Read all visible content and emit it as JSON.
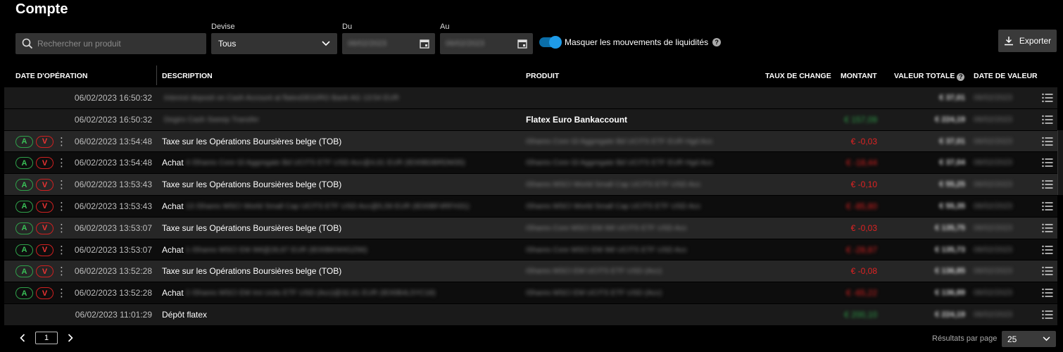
{
  "header": {
    "title": "Compte"
  },
  "filters": {
    "search_placeholder": "Rechercher un produit",
    "currency_label": "Devise",
    "currency_value": "Tous",
    "from_label": "Du",
    "from_value": "06/02/2023",
    "to_label": "Au",
    "to_value": "06/02/2023",
    "toggle_label": "Masquer les mouvements de liquidités",
    "toggle_on": true,
    "export_label": "Exporter"
  },
  "table": {
    "columns": {
      "op_date": "DATE D'OPÉRATION",
      "description": "DESCRIPTION",
      "product": "PRODUIT",
      "fx": "TAUX DE CHANGE",
      "amount": "MONTANT",
      "total": "VALEUR TOTALE",
      "value_date": "DATE DE VALEUR"
    },
    "buy_label": "A",
    "sell_label": "V",
    "rows": [
      {
        "has_actions": false,
        "datetime": "06/02/2023 16:50:32",
        "desc": "",
        "desc_blur": "Interest deposit on Cash Account at flatexDEGIRO Bank AG 13:54 EUR",
        "product": "",
        "product_blur": "",
        "amount": "",
        "amount_blur": true,
        "amount_pos": false,
        "total": "€ 37,01",
        "value_date": "06/02/2023"
      },
      {
        "has_actions": false,
        "datetime": "06/02/2023 16:50:32",
        "desc": "",
        "desc_blur": "Degiro Cash Sweep Transfer",
        "product": "Flatex Euro Bankaccount",
        "product_blur": "",
        "amount": "€ 157,09",
        "amount_blur": true,
        "amount_pos": true,
        "total": "€ 224,19",
        "value_date": "06/02/2023"
      },
      {
        "has_actions": true,
        "datetime": "06/02/2023 13:54:48",
        "desc": "Taxe sur les Opérations Boursières belge (TOB)",
        "desc_blur": "",
        "product": "",
        "product_blur": "iShares Core Gl Aggregate Bd UCITS ETF EUR Hgd Acc",
        "amount": "€ -0,03",
        "amount_blur": false,
        "amount_pos": false,
        "total": "€ 37,01",
        "value_date": "06/02/2023"
      },
      {
        "has_actions": true,
        "datetime": "06/02/2023 13:54:48",
        "desc": "Achat",
        "desc_blur": "4 iShares Core Gl Aggregate Bd UCITS ETF USD Acc@4,61 EUR (IE00BDBRDM35)",
        "product": "",
        "product_blur": "iShares Core Gl Aggregate Bd UCITS ETF EUR Hgd Acc",
        "amount": "€ -18,44",
        "amount_blur": true,
        "amount_pos": false,
        "total": "€ 37,04",
        "value_date": "06/02/2023"
      },
      {
        "has_actions": true,
        "datetime": "06/02/2023 13:53:43",
        "desc": "Taxe sur les Opérations Boursières belge (TOB)",
        "desc_blur": "",
        "product": "",
        "product_blur": "iShares MSCI World Small Cap UCITS ETF USD Acc",
        "amount": "€ -0,10",
        "amount_blur": false,
        "amount_pos": false,
        "total": "€ 55,25",
        "value_date": "06/02/2023"
      },
      {
        "has_actions": true,
        "datetime": "06/02/2023 13:53:43",
        "desc": "Achat",
        "desc_blur": "13 iShares MSCI World Small Cap UCITS ETF USD Acc@5,59 EUR (IE00BF4RFH31)",
        "product": "",
        "product_blur": "iShares MSCI World Small Cap UCITS ETF USD Acc",
        "amount": "€ -85,80",
        "amount_blur": true,
        "amount_pos": false,
        "total": "€ 55,35",
        "value_date": "06/02/2023"
      },
      {
        "has_actions": true,
        "datetime": "06/02/2023 13:53:07",
        "desc": "Taxe sur les Opérations Boursières belge (TOB)",
        "desc_blur": "",
        "product": "",
        "product_blur": "iShares Core MSCI EM IMI UCITS ETF USD Acc",
        "amount": "€ -0,03",
        "amount_blur": false,
        "amount_pos": false,
        "total": "€ 135,75",
        "value_date": "06/02/2023"
      },
      {
        "has_actions": true,
        "datetime": "06/02/2023 13:53:07",
        "desc": "Achat",
        "desc_blur": "1 iShares MSCI EM IMI@28,87 EUR (IE00BKM4GZ66)",
        "product": "",
        "product_blur": "iShares Core MSCI EM IMI UCITS ETF USD Acc",
        "amount": "€ -28,87",
        "amount_blur": true,
        "amount_pos": false,
        "total": "€ 135,73",
        "value_date": "06/02/2023"
      },
      {
        "has_actions": true,
        "datetime": "06/02/2023 13:52:28",
        "desc": "Taxe sur les Opérations Boursières belge (TOB)",
        "desc_blur": "",
        "product": "",
        "product_blur": "iShares MSCI EM UCITS ETF USD (Acc)",
        "amount": "€ -0,08",
        "amount_blur": false,
        "amount_pos": false,
        "total": "€ 136,85",
        "value_date": "06/02/2023"
      },
      {
        "has_actions": true,
        "datetime": "06/02/2023 13:52:28",
        "desc": "Achat",
        "desc_blur": "2 iShares MSCI EM Imi Ucits ETF USD (Acc)@32,61 EUR (IE00B4L5YC18)",
        "product": "",
        "product_blur": "iShares MSCI EM UCITS ETF USD (Acc)",
        "amount": "€ -65,22",
        "amount_blur": true,
        "amount_pos": false,
        "total": "€ 136,89",
        "value_date": "06/02/2023"
      },
      {
        "has_actions": false,
        "datetime": "06/02/2023 11:01:29",
        "desc": "Dépôt flatex",
        "desc_blur": "",
        "product": "",
        "product_blur": "",
        "amount": "€ 200,10",
        "amount_blur": true,
        "amount_pos": true,
        "total": "€ 224,19",
        "value_date": "06/02/2023"
      }
    ]
  },
  "pagination": {
    "page": "1",
    "results_label": "Résultats par page",
    "per_page": "25"
  },
  "colors": {
    "accent": "#1e9be8",
    "buy": "#39c057",
    "sell": "#ee3333"
  },
  "icons": [
    "search-icon",
    "chevron-down-icon",
    "calendar-icon",
    "help-icon",
    "download-icon",
    "list-icon",
    "kebab-icon",
    "chevron-left-icon",
    "chevron-right-icon"
  ]
}
